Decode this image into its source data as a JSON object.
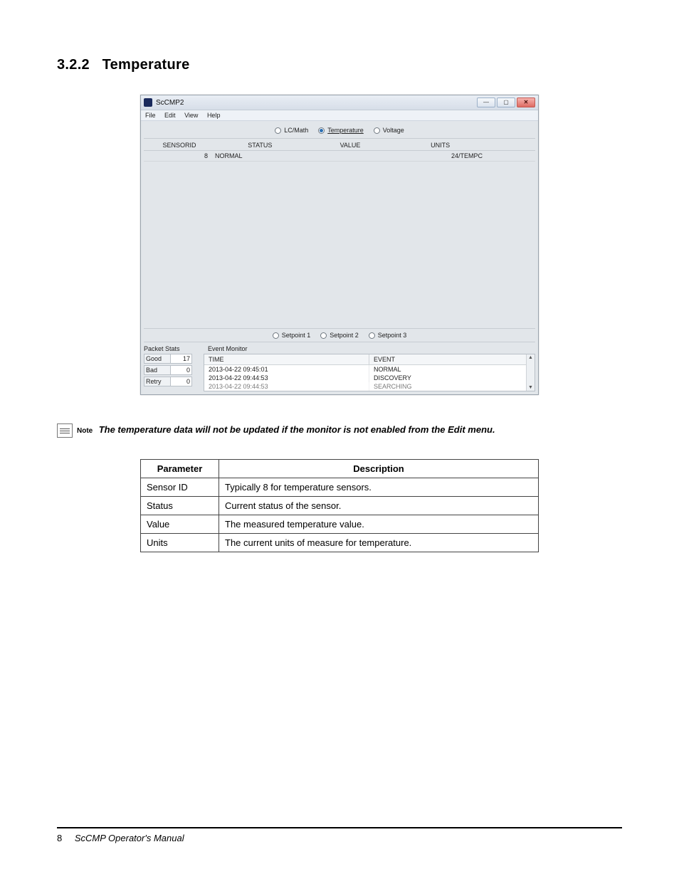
{
  "heading": {
    "number": "3.2.2",
    "title": "Temperature"
  },
  "app": {
    "title": "ScCMP2",
    "menu": {
      "file": "File",
      "edit": "Edit",
      "view": "View",
      "help": "Help"
    },
    "window_btns": {
      "min": "—",
      "max": "▢",
      "close": "✕"
    },
    "top_tabs": {
      "lcmath": "LC/Math",
      "temperature": "Temperature",
      "voltage": "Voltage"
    },
    "grid_headers": {
      "sensorid": "SENSORID",
      "status": "STATUS",
      "value": "VALUE",
      "units": "UNITS"
    },
    "grid_row": {
      "sensorid": "8",
      "status": "NORMAL",
      "value": "",
      "units": "24/TEMPC"
    },
    "setpoints": {
      "sp1": "Setpoint 1",
      "sp2": "Setpoint 2",
      "sp3": "Setpoint 3"
    },
    "packet_stats": {
      "title": "Packet Stats",
      "rows": [
        {
          "label": "Good",
          "value": "17"
        },
        {
          "label": "Bad",
          "value": "0"
        },
        {
          "label": "Retry",
          "value": "0"
        }
      ]
    },
    "event_monitor": {
      "title": "Event Monitor",
      "headers": {
        "time": "TIME",
        "event": "EVENT"
      },
      "rows": [
        {
          "time": "2013-04-22 09:45:01",
          "event": "NORMAL"
        },
        {
          "time": "2013-04-22 09:44:53",
          "event": "DISCOVERY"
        },
        {
          "time": "2013-04-22 09:44:53",
          "event": "SEARCHING"
        }
      ]
    }
  },
  "note": {
    "label": "Note",
    "text": "The temperature data will not be updated if the monitor is not enabled from the Edit menu."
  },
  "param_table": {
    "headers": {
      "param": "Parameter",
      "desc": "Description"
    },
    "rows": [
      {
        "param": "Sensor ID",
        "desc": "Typically 8 for temperature sensors."
      },
      {
        "param": "Status",
        "desc": "Current status of the sensor."
      },
      {
        "param": "Value",
        "desc": "The measured temperature value."
      },
      {
        "param": "Units",
        "desc": "The current units of measure for temperature."
      }
    ]
  },
  "footer": {
    "page": "8",
    "title": "ScCMP Operator's Manual"
  }
}
